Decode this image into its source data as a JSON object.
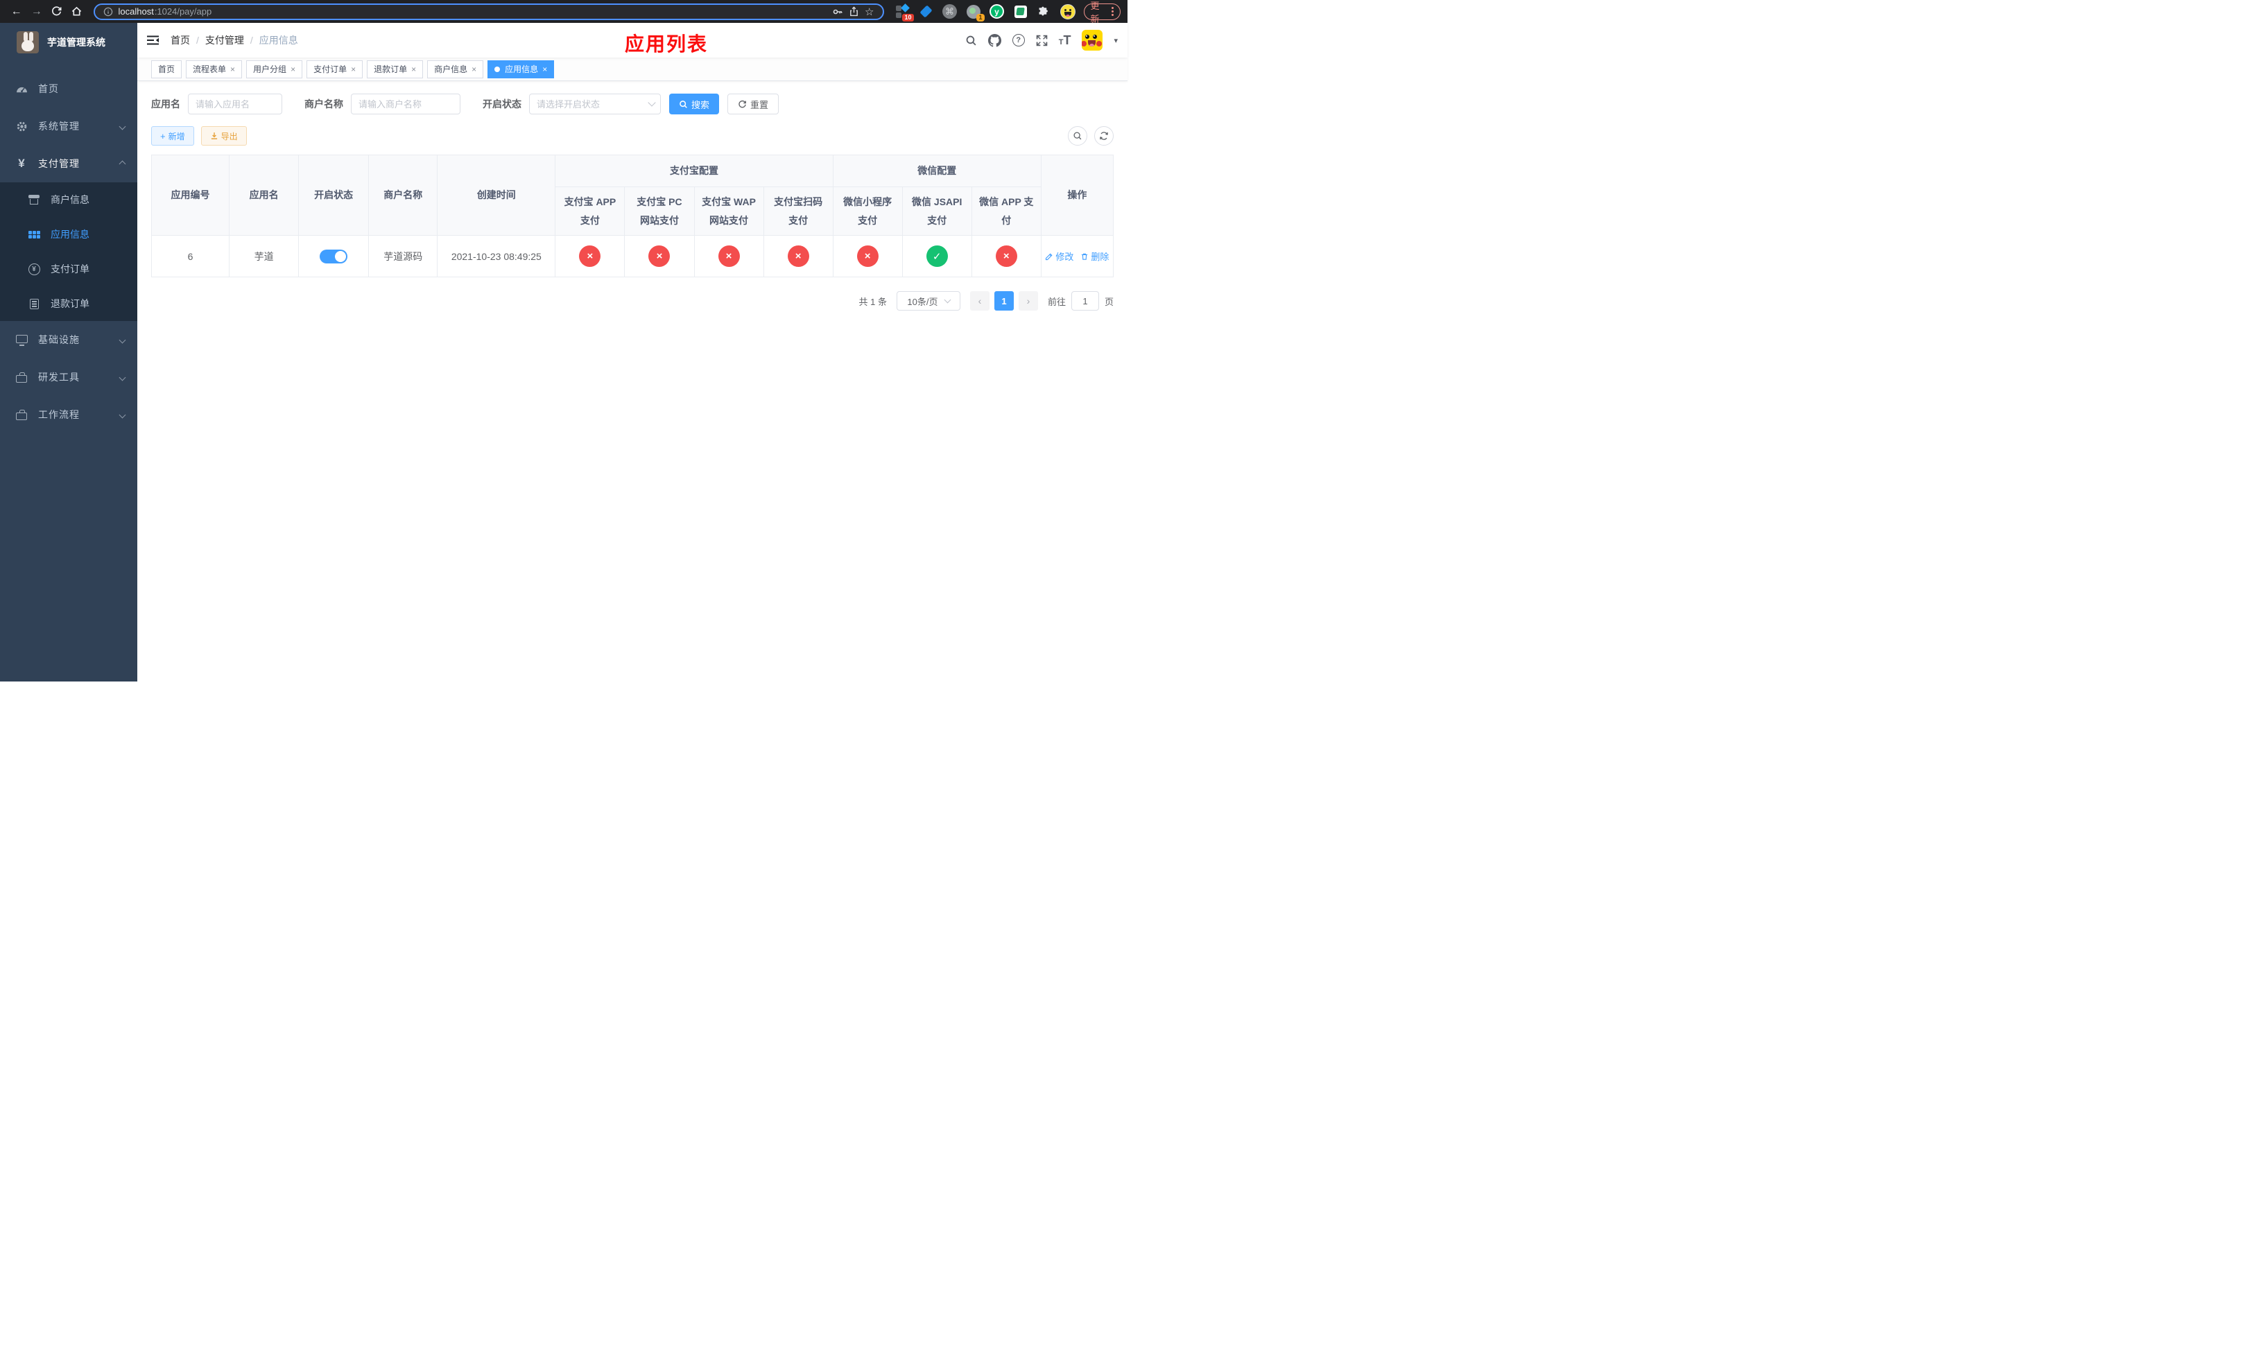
{
  "browser": {
    "url_host": "localhost",
    "url_rest": ":1024/pay/app",
    "update_label": "更新",
    "ext_badge_1": "10",
    "ext_badge_2": "1"
  },
  "sidebar": {
    "title": "芋道管理系统",
    "items": [
      {
        "label": "首页"
      },
      {
        "label": "系统管理"
      },
      {
        "label": "支付管理"
      },
      {
        "label": "商户信息"
      },
      {
        "label": "应用信息"
      },
      {
        "label": "支付订单"
      },
      {
        "label": "退款订单"
      },
      {
        "label": "基础设施"
      },
      {
        "label": "研发工具"
      },
      {
        "label": "工作流程"
      }
    ]
  },
  "header": {
    "breadcrumb": [
      "首页",
      "支付管理",
      "应用信息"
    ],
    "annotation": "应用列表"
  },
  "tabs": [
    {
      "label": "首页"
    },
    {
      "label": "流程表单"
    },
    {
      "label": "用户分组"
    },
    {
      "label": "支付订单"
    },
    {
      "label": "退款订单"
    },
    {
      "label": "商户信息"
    },
    {
      "label": "应用信息"
    }
  ],
  "filters": {
    "app_name_label": "应用名",
    "app_name_placeholder": "请输入应用名",
    "merchant_label": "商户名称",
    "merchant_placeholder": "请输入商户名称",
    "status_label": "开启状态",
    "status_placeholder": "请选择开启状态",
    "search_label": "搜索",
    "reset_label": "重置"
  },
  "toolbar": {
    "add_label": "新增",
    "export_label": "导出"
  },
  "table": {
    "columns": [
      "应用编号",
      "应用名",
      "开启状态",
      "商户名称",
      "创建时间"
    ],
    "group_alipay": "支付宝配置",
    "group_wechat": "微信配置",
    "column_op": "操作",
    "sub_columns": [
      "支付宝 APP 支付",
      "支付宝 PC 网站支付",
      "支付宝 WAP 网站支付",
      "支付宝扫码支付",
      "微信小程序支付",
      "微信 JSAPI 支付",
      "微信 APP 支付"
    ],
    "row": {
      "id": "6",
      "name": "芋道",
      "enabled": true,
      "merchant": "芋道源码",
      "created_at": "2021-10-23 08:49:25",
      "channels": [
        "fail",
        "fail",
        "fail",
        "fail",
        "fail",
        "success",
        "fail"
      ],
      "edit_label": "修改",
      "delete_label": "删除"
    }
  },
  "pagination": {
    "total_label": "共 1 条",
    "page_size": "10条/页",
    "current_page": "1",
    "goto_label": "前往",
    "goto_value": "1",
    "page_unit": "页"
  },
  "colors": {
    "accent": "#409eff",
    "danger": "#f34d4d",
    "success": "#16c172",
    "sidebar_bg": "#304156",
    "submenu_bg": "#1f2d3d"
  }
}
